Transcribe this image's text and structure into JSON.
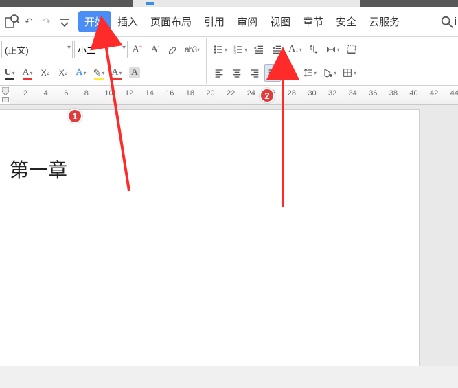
{
  "tabs": {
    "start": "开始",
    "insert": "插入",
    "layout": "页面布局",
    "reference": "引用",
    "review": "审阅",
    "view": "视图",
    "section": "章节",
    "security": "安全",
    "cloud": "云服务"
  },
  "search_tail": "i",
  "font": {
    "name": "(正文)",
    "size": "小二"
  },
  "ruler_numbers": [
    "2",
    "4",
    "6",
    "8",
    "10",
    "12",
    "14",
    "16",
    "18",
    "20",
    "22",
    "24",
    "26",
    "28",
    "30",
    "32",
    "34",
    "36",
    "38",
    "40",
    "42",
    "44"
  ],
  "doc": {
    "heading": "第一章"
  },
  "annotations": {
    "badge1": "1",
    "badge2": "2"
  }
}
